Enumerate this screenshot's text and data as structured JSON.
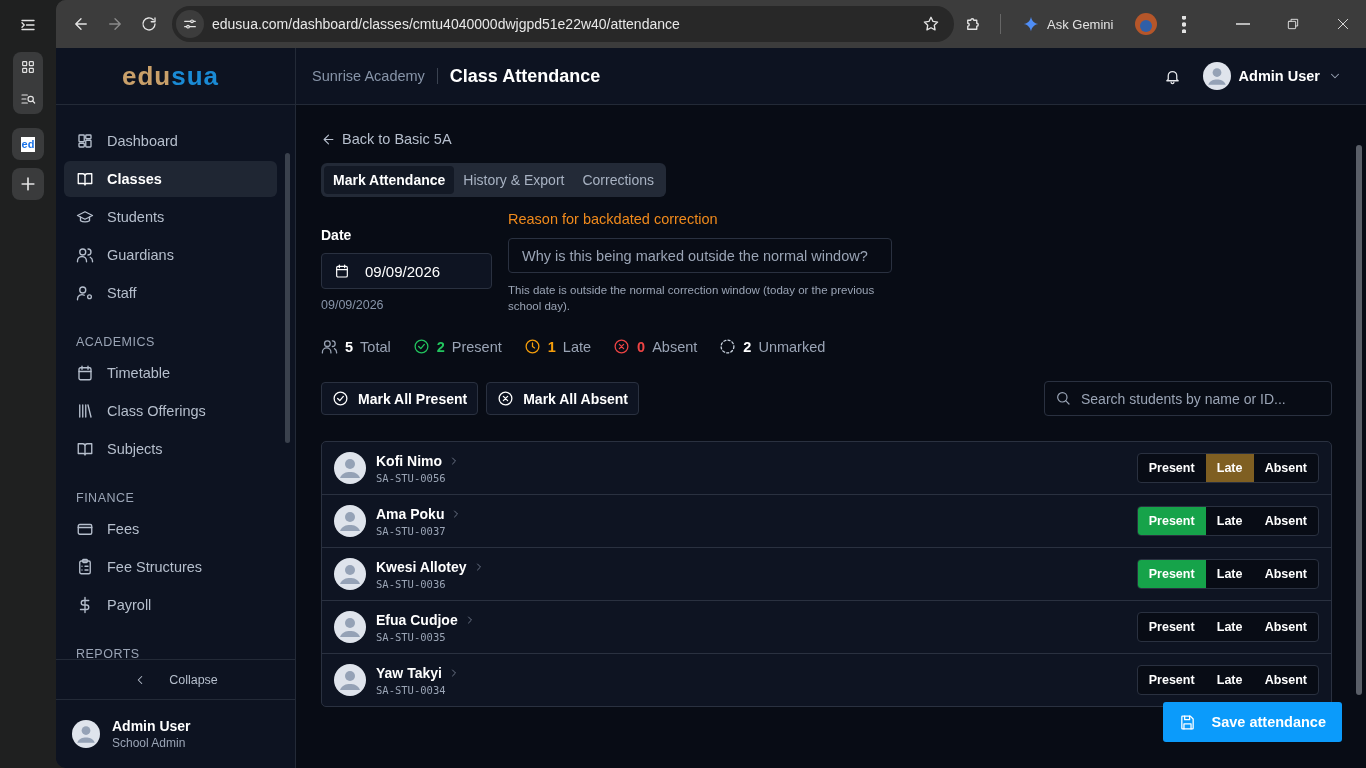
{
  "browser": {
    "favicon_text": "ed",
    "url": "edusua.com/dashboard/classes/cmtu4040000dwjgpd51e22w40/attendance",
    "gemini_label": "Ask Gemini"
  },
  "sidebar": {
    "logo": [
      {
        "text": "edu",
        "color": "#c9a06a"
      },
      {
        "text": "sua",
        "color": "#1a8ad4"
      }
    ],
    "sections": [
      {
        "items": [
          {
            "label": "Dashboard",
            "selected": false
          },
          {
            "label": "Classes",
            "selected": true
          },
          {
            "label": "Students",
            "selected": false
          },
          {
            "label": "Guardians",
            "selected": false
          },
          {
            "label": "Staff",
            "selected": false
          }
        ]
      },
      {
        "heading": "ACADEMICS",
        "items": [
          {
            "label": "Timetable",
            "selected": false
          },
          {
            "label": "Class Offerings",
            "selected": false
          },
          {
            "label": "Subjects",
            "selected": false
          }
        ]
      },
      {
        "heading": "FINANCE",
        "items": [
          {
            "label": "Fees",
            "selected": false
          },
          {
            "label": "Fee Structures",
            "selected": false
          },
          {
            "label": "Payroll",
            "selected": false
          }
        ]
      },
      {
        "heading": "REPORTS"
      }
    ],
    "collapse_label": "Collapse",
    "user": {
      "name": "Admin User",
      "role": "School Admin"
    }
  },
  "header": {
    "school": "Sunrise Academy",
    "title": "Class Attendance",
    "user_name": "Admin User"
  },
  "main": {
    "back_link": "Back to Basic 5A",
    "tabs": [
      {
        "label": "Mark Attendance",
        "selected": true
      },
      {
        "label": "History & Export",
        "selected": false
      },
      {
        "label": "Corrections",
        "selected": false
      }
    ],
    "date": {
      "label": "Date",
      "value": "09/09/2026",
      "caption": "09/09/2026"
    },
    "reason": {
      "label": "Reason for backdated correction",
      "placeholder": "Why is this being marked outside the normal window?",
      "note": "This date is outside the normal correction window (today or the previous school day)."
    },
    "stats": [
      {
        "kind": "total",
        "count": "5",
        "label": "Total"
      },
      {
        "kind": "present",
        "count": "2",
        "label": "Present"
      },
      {
        "kind": "late",
        "count": "1",
        "label": "Late"
      },
      {
        "kind": "absent",
        "count": "0",
        "label": "Absent"
      },
      {
        "kind": "unmarked",
        "count": "2",
        "label": "Unmarked"
      }
    ],
    "actions": [
      {
        "kind": "present",
        "label": "Mark All Present"
      },
      {
        "kind": "absent",
        "label": "Mark All Absent"
      }
    ],
    "search": {
      "placeholder": "Search students by name or ID..."
    },
    "students": [
      {
        "name": "Kofi Nimo",
        "id": "SA-STU-0056",
        "options": [
          {
            "label": "Present",
            "selected": false
          },
          {
            "label": "Late",
            "selected": true
          },
          {
            "label": "Absent",
            "selected": false
          }
        ]
      },
      {
        "name": "Ama Poku",
        "id": "SA-STU-0037",
        "options": [
          {
            "label": "Present",
            "selected": true
          },
          {
            "label": "Late",
            "selected": false
          },
          {
            "label": "Absent",
            "selected": false
          }
        ]
      },
      {
        "name": "Kwesi Allotey",
        "id": "SA-STU-0036",
        "options": [
          {
            "label": "Present",
            "selected": true
          },
          {
            "label": "Late",
            "selected": false
          },
          {
            "label": "Absent",
            "selected": false
          }
        ]
      },
      {
        "name": "Efua Cudjoe",
        "id": "SA-STU-0035",
        "options": [
          {
            "label": "Present",
            "selected": false
          },
          {
            "label": "Late",
            "selected": false
          },
          {
            "label": "Absent",
            "selected": false
          }
        ]
      },
      {
        "name": "Yaw Takyi",
        "id": "SA-STU-0034",
        "options": [
          {
            "label": "Present",
            "selected": false
          },
          {
            "label": "Late",
            "selected": false
          },
          {
            "label": "Absent",
            "selected": false
          }
        ]
      }
    ],
    "save_button": "Save attendance"
  }
}
